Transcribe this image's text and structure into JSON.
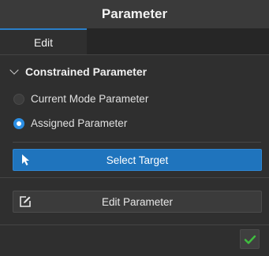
{
  "window": {
    "title": "Parameter"
  },
  "tabs": [
    {
      "label": "Edit",
      "active": true
    }
  ],
  "constrained_section": {
    "title": "Constrained Parameter",
    "expanded": true,
    "options": [
      {
        "label": "Current Mode Parameter",
        "selected": false
      },
      {
        "label": "Assigned Parameter",
        "selected": true
      }
    ],
    "select_target_button": {
      "label": "Select Target",
      "icon": "cursor-arrow-icon"
    }
  },
  "edit_section": {
    "edit_parameter_button": {
      "label": "Edit Parameter",
      "icon": "edit-square-icon"
    }
  },
  "footer": {
    "ok_icon": "checkmark-icon"
  },
  "colors": {
    "accent": "#2b8ee3",
    "primary_button": "#1f74bd",
    "ok_check": "#3fbf3f",
    "background": "#2f2f2f"
  }
}
